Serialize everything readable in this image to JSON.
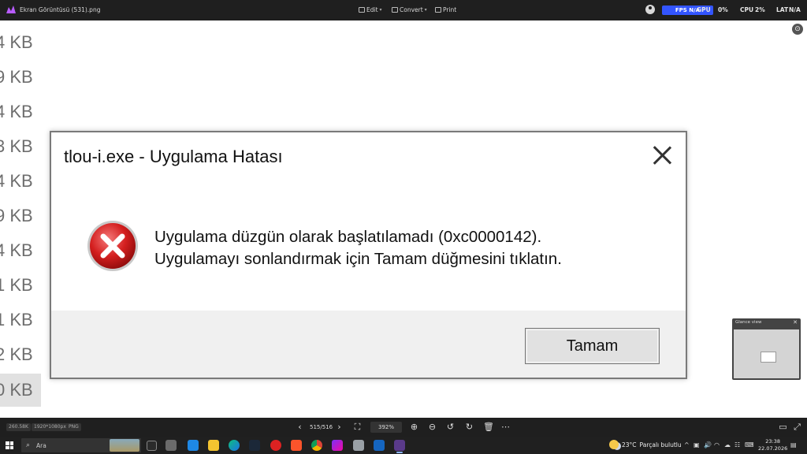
{
  "app": {
    "file_title": "Ekran Görüntüsü (531).png",
    "menu": {
      "edit": "Edit",
      "convert": "Convert",
      "print": "Print"
    },
    "overlay": {
      "fps_label": "FPS N/A",
      "gpu_label": "GPU",
      "gpu_value": "0%",
      "cpu_label": "CPU",
      "cpu_value": "2%",
      "lat_label": "LAT",
      "lat_value": "N/A"
    }
  },
  "background_sizes": [
    "4 KB",
    "9 KB",
    "4 KB",
    "3 KB",
    "4 KB",
    "9 KB",
    "4 KB",
    "1 KB",
    "1 KB",
    "2 KB",
    "0 KB"
  ],
  "dialog": {
    "title": "tlou-i.exe - Uygulama Hatası",
    "message_line1": "Uygulama düzgün olarak başlatılamadı (0xc0000142).",
    "message_line2": "Uygulamayı sonlandırmak için Tamam düğmesini tıklatın.",
    "ok_label": "Tamam"
  },
  "glance": {
    "title": "Glance view"
  },
  "statusbar": {
    "file_size": "260.58K",
    "resolution": "1920*1080px",
    "format": "PNG",
    "page": "515/516",
    "zoom": "392%"
  },
  "taskbar": {
    "search_placeholder": "Ara",
    "weather_temp": "23°C",
    "weather_text": "Parçalı bulutlu",
    "time": "23:38",
    "date": "22.07.2026"
  }
}
